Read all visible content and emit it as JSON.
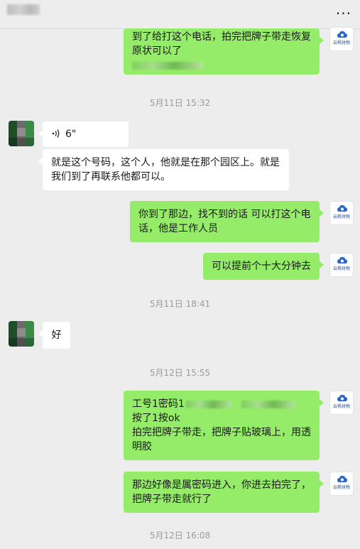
{
  "header": {
    "more_icon": "more-dots-icon"
  },
  "avatar_me": {
    "brand": "云帆财税",
    "icon": "cloud-logo-icon"
  },
  "messages": [
    {
      "line1": "到了给打这个电话，拍完把牌子带走恢复",
      "line2": "原状可以了"
    },
    {
      "time": "5月11日 15:32"
    },
    {
      "voice": "6\""
    },
    {
      "text": "就是这个号码，这个人，他就是在那个园区上。就是我们到了再联系他都可以。"
    },
    {
      "text": "你到了那边，找不到的话 可以打这个电话，他是工作人员"
    },
    {
      "text": "可以提前个十大分钟去"
    },
    {
      "time": "5月11日 18:41"
    },
    {
      "text": "好"
    },
    {
      "time": "5月12日 15:55"
    },
    {
      "line1": "工号1密码1",
      "line2": "按了1按ok",
      "line3": "拍完把牌子带走，把牌子贴玻璃上，用透明胶"
    },
    {
      "text": "那边好像是属密码进入，你进去拍完了，把牌子带走就行了"
    },
    {
      "time": "5月12日 16:08"
    }
  ]
}
